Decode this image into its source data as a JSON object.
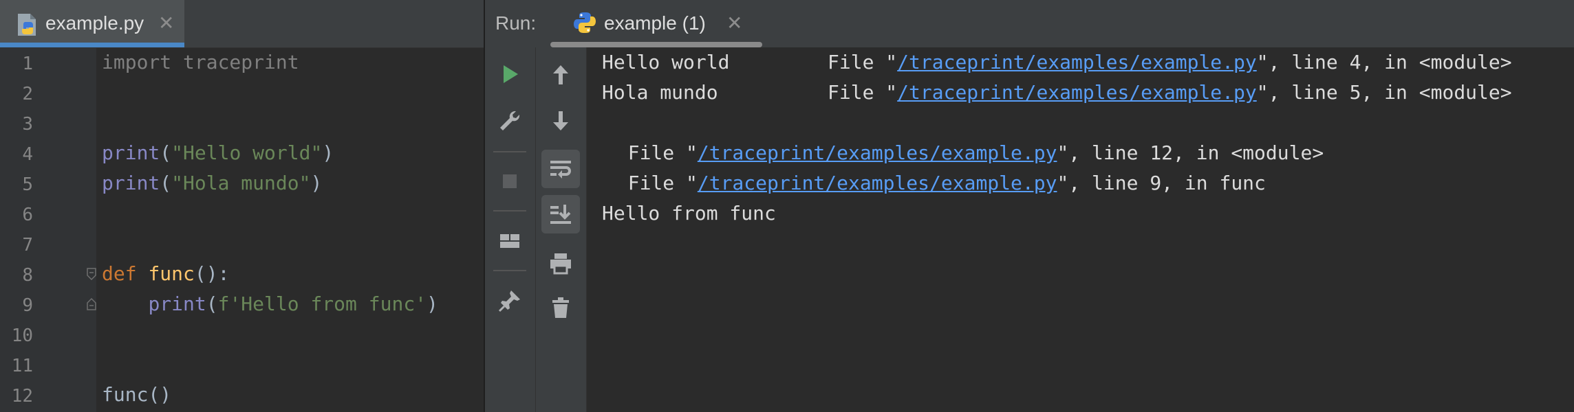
{
  "editor": {
    "tab": {
      "label": "example.py",
      "close": "✕"
    },
    "line_numbers": [
      "1",
      "2",
      "3",
      "4",
      "5",
      "6",
      "7",
      "8",
      "9",
      "10",
      "11",
      "12"
    ],
    "code": {
      "l1": "import traceprint",
      "l4_fn": "print",
      "l4_open": "(",
      "l4_str": "\"Hello world\"",
      "l4_close": ")",
      "l5_fn": "print",
      "l5_open": "(",
      "l5_str": "\"Hola mundo\"",
      "l5_close": ")",
      "l8_kw": "def",
      "l8_name": "func",
      "l8_rest": "():",
      "l9_indent": "    ",
      "l9_fn": "print",
      "l9_open": "(",
      "l9_str": "f'Hello from func'",
      "l9_close": ")",
      "l12": "func()"
    }
  },
  "run": {
    "label": "Run:",
    "tab_label": "example (1)",
    "tab_close": "✕"
  },
  "toolbar": {
    "icons": [
      "run-icon",
      "wrench-icon",
      "stop-icon",
      "layout-icon",
      "pin-icon",
      "up-arrow-icon",
      "down-arrow-icon",
      "soft-wrap-icon",
      "scroll-to-end-icon",
      "print-icon",
      "trash-icon"
    ]
  },
  "console": {
    "line1": {
      "msg": "Hello world",
      "pre": "File \"",
      "path": "/traceprint/examples/example.py",
      "post": "\", line 4, in <module>"
    },
    "line2": {
      "msg": "Hola mundo",
      "pre": "File \"",
      "path": "/traceprint/examples/example.py",
      "post": "\", line 5, in <module>"
    },
    "line4": {
      "pre": "  File \"",
      "path": "/traceprint/examples/example.py",
      "post": "\", line 12, in <module>"
    },
    "line5": {
      "pre": "  File \"",
      "path": "/traceprint/examples/example.py",
      "post": "\", line 9, in func"
    },
    "line6": "Hello from func"
  },
  "colors": {
    "keyword": "#cc7832",
    "builtin": "#8888c6",
    "string": "#6a8759",
    "function": "#ffc66d",
    "link": "#589df6",
    "run_green": "#59a869",
    "tab_accent": "#4a88c7"
  }
}
